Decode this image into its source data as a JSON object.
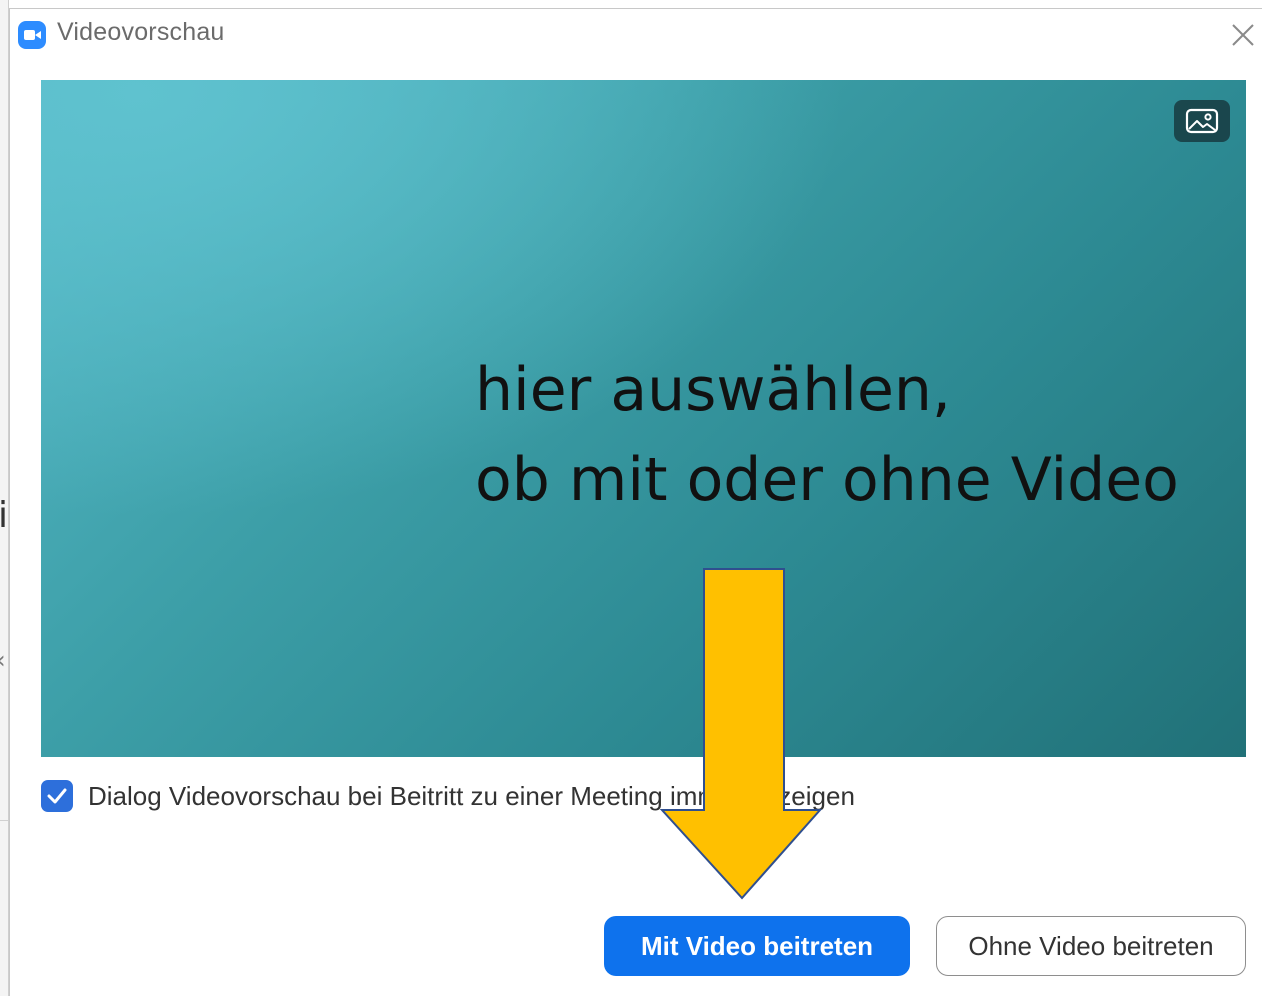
{
  "window": {
    "title": "Videovorschau",
    "accent_color": "#2d8cff"
  },
  "preview": {
    "background_button_icon": "image-background-icon",
    "gradient_colors": [
      "#5fc2cf",
      "#3d9fa8",
      "#217178"
    ]
  },
  "annotation": {
    "line1": "hier auswählen,",
    "line2": "ob mit oder ohne Video",
    "arrow_color": "#ffc000",
    "arrow_icon": "down-arrow-icon"
  },
  "options": {
    "show_preview_checked": true,
    "show_preview_label": "Dialog Videovorschau bei Beitritt zu einer Meeting immer anzeigen"
  },
  "buttons": {
    "join_with_video": "Mit Video beitreten",
    "join_without_video": "Ohne Video beitreten",
    "primary_color": "#0e72ed"
  }
}
